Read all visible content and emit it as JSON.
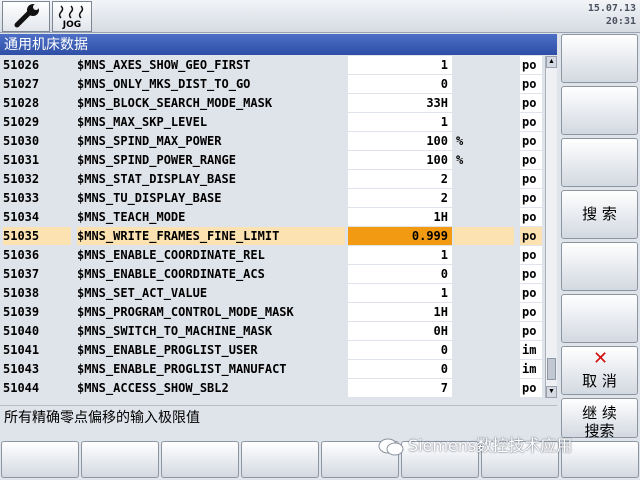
{
  "topbar": {
    "jog_label": "JOG",
    "date": "15.07.13",
    "time": "20:31"
  },
  "title": "通用机床数据",
  "rows": [
    {
      "num": "51026",
      "name": "$MNS_AXES_SHOW_GEO_FIRST",
      "value": "1",
      "unit": "",
      "attr": "po"
    },
    {
      "num": "51027",
      "name": "$MNS_ONLY_MKS_DIST_TO_GO",
      "value": "0",
      "unit": "",
      "attr": "po"
    },
    {
      "num": "51028",
      "name": "$MNS_BLOCK_SEARCH_MODE_MASK",
      "value": "33H",
      "unit": "",
      "attr": "po"
    },
    {
      "num": "51029",
      "name": "$MNS_MAX_SKP_LEVEL",
      "value": "1",
      "unit": "",
      "attr": "po"
    },
    {
      "num": "51030",
      "name": "$MNS_SPIND_MAX_POWER",
      "value": "100",
      "unit": "%",
      "attr": "po"
    },
    {
      "num": "51031",
      "name": "$MNS_SPIND_POWER_RANGE",
      "value": "100",
      "unit": "%",
      "attr": "po"
    },
    {
      "num": "51032",
      "name": "$MNS_STAT_DISPLAY_BASE",
      "value": "2",
      "unit": "",
      "attr": "po"
    },
    {
      "num": "51033",
      "name": "$MNS_TU_DISPLAY_BASE",
      "value": "2",
      "unit": "",
      "attr": "po"
    },
    {
      "num": "51034",
      "name": "$MNS_TEACH_MODE",
      "value": "1H",
      "unit": "",
      "attr": "po"
    },
    {
      "num": "51035",
      "name": "$MNS_WRITE_FRAMES_FINE_LIMIT",
      "value": "0.999",
      "unit": "",
      "attr": "po",
      "selected": true
    },
    {
      "num": "51036",
      "name": "$MNS_ENABLE_COORDINATE_REL",
      "value": "1",
      "unit": "",
      "attr": "po"
    },
    {
      "num": "51037",
      "name": "$MNS_ENABLE_COORDINATE_ACS",
      "value": "0",
      "unit": "",
      "attr": "po"
    },
    {
      "num": "51038",
      "name": "$MNS_SET_ACT_VALUE",
      "value": "1",
      "unit": "",
      "attr": "po"
    },
    {
      "num": "51039",
      "name": "$MNS_PROGRAM_CONTROL_MODE_MASK",
      "value": "1H",
      "unit": "",
      "attr": "po"
    },
    {
      "num": "51040",
      "name": "$MNS_SWITCH_TO_MACHINE_MASK",
      "value": "0H",
      "unit": "",
      "attr": "po"
    },
    {
      "num": "51041",
      "name": "$MNS_ENABLE_PROGLIST_USER",
      "value": "0",
      "unit": "",
      "attr": "im"
    },
    {
      "num": "51043",
      "name": "$MNS_ENABLE_PROGLIST_MANUFACT",
      "value": "0",
      "unit": "",
      "attr": "im"
    },
    {
      "num": "51044",
      "name": "$MNS_ACCESS_SHOW_SBL2",
      "value": "7",
      "unit": "",
      "attr": "po"
    }
  ],
  "status_text": "所有精确零点偏移的输入极限值",
  "softkeys_right": {
    "search": "搜 索",
    "cancel": "取 消",
    "continue_line1": "继 续",
    "continue_line2": "搜索"
  },
  "watermark": "Siemens数控技术应用",
  "colors": {
    "title_bg": "#2f4fa6",
    "selected_row": "#fbe2b0",
    "selected_value": "#f39a13",
    "cancel_icon": "#d40f0f"
  }
}
